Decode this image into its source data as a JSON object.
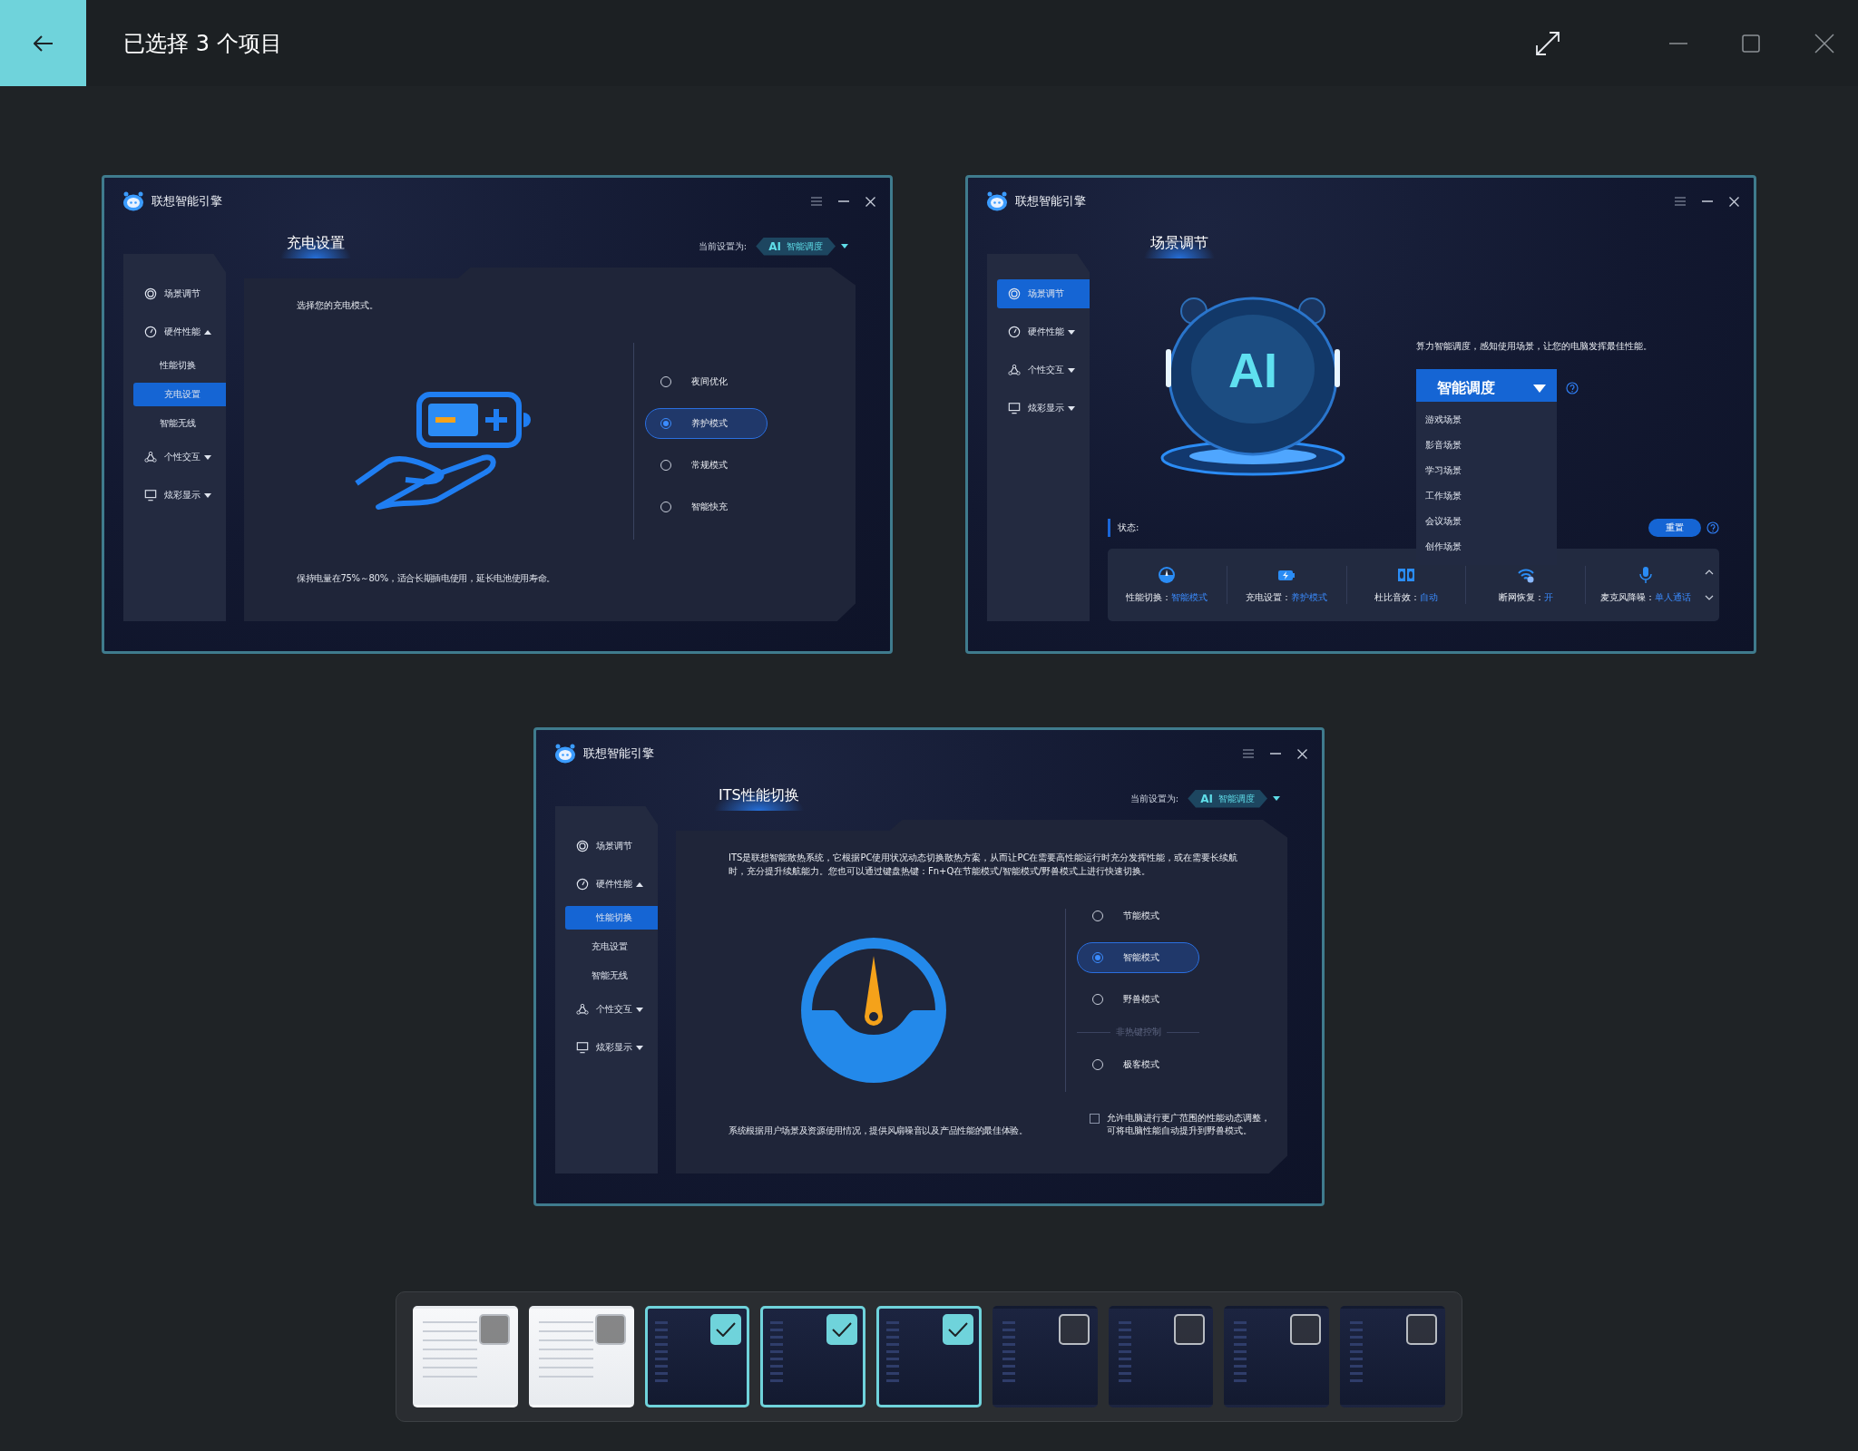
{
  "window": {
    "title": "已选择 3 个项目"
  },
  "screenshots": [
    {
      "app_title": "联想智能引擎",
      "page_title": "充电设置",
      "current_setting": {
        "label": "当前设置为:",
        "badge_prefix": "AI",
        "badge_text": "智能调度"
      },
      "sidebar": [
        {
          "label": "场景调节",
          "selected": false
        },
        {
          "label": "硬件性能",
          "selected": false,
          "expanded": true,
          "children": [
            {
              "label": "性能切换",
              "selected": false
            },
            {
              "label": "充电设置",
              "selected": true
            },
            {
              "label": "智能无线",
              "selected": false
            }
          ]
        },
        {
          "label": "个性交互",
          "selected": false,
          "expanded": false
        },
        {
          "label": "炫彩显示",
          "selected": false,
          "expanded": false
        }
      ],
      "content": {
        "kind": "charging",
        "description": "选择您的充电模式。",
        "footer": "保持电量在75%～80%，适合长期插电使用，延长电池使用寿命。",
        "options": [
          {
            "kind": "radio",
            "label": "夜间优化",
            "selected": false
          },
          {
            "kind": "radio",
            "label": "养护模式",
            "selected": true
          },
          {
            "kind": "radio",
            "label": "常规模式",
            "selected": false
          },
          {
            "kind": "radio",
            "label": "智能快充",
            "selected": false
          }
        ]
      }
    },
    {
      "app_title": "联想智能引擎",
      "page_title": "场景调节",
      "sidebar": [
        {
          "label": "场景调节",
          "selected": true
        },
        {
          "label": "硬件性能",
          "selected": false,
          "expanded": false
        },
        {
          "label": "个性交互",
          "selected": false,
          "expanded": false
        },
        {
          "label": "炫彩显示",
          "selected": false,
          "expanded": false
        }
      ],
      "content": {
        "kind": "scene",
        "mascot_text": "AI",
        "description": "算力智能调度，感知使用场景，让您的电脑发挥最佳性能。",
        "dropdown": {
          "label": "智能调度",
          "expanded": true,
          "options": [
            "游戏场景",
            "影音场景",
            "学习场景",
            "工作场景",
            "会议场景",
            "创作场景"
          ]
        },
        "status_label": "状态:",
        "reset_button": "重置",
        "status_items": [
          {
            "label": "性能切换：",
            "value": "智能模式"
          },
          {
            "label": "充电设置：",
            "value": "养护模式"
          },
          {
            "label": "杜比音效：",
            "value": "自动"
          },
          {
            "label": "断网恢复：",
            "value": "开"
          },
          {
            "label": "麦克风降噪：",
            "value": "单人通话"
          }
        ]
      }
    },
    {
      "app_title": "联想智能引擎",
      "page_title": "ITS性能切换",
      "current_setting": {
        "label": "当前设置为:",
        "badge_prefix": "AI",
        "badge_text": "智能调度"
      },
      "sidebar": [
        {
          "label": "场景调节",
          "selected": false
        },
        {
          "label": "硬件性能",
          "selected": false,
          "expanded": true,
          "children": [
            {
              "label": "性能切换",
              "selected": true
            },
            {
              "label": "充电设置",
              "selected": false
            },
            {
              "label": "智能无线",
              "selected": false
            }
          ]
        },
        {
          "label": "个性交互",
          "selected": false,
          "expanded": false
        },
        {
          "label": "炫彩显示",
          "selected": false,
          "expanded": false
        }
      ],
      "content": {
        "kind": "performance",
        "description": "ITS是联想智能散热系统，它根据PC使用状况动态切换散热方案，从而让PC在需要高性能运行时充分发挥性能，或在需要长续航时，充分提升续航能力。您也可以通过键盘热键：Fn+Q在节能模式/智能模式/野兽模式上进行快速切换。",
        "footer": "系统根据用户场景及资源使用情况，提供风扇噪音以及产品性能的最佳体验。",
        "options": [
          {
            "kind": "radio",
            "label": "节能模式",
            "selected": false
          },
          {
            "kind": "radio",
            "label": "智能模式",
            "selected": true
          },
          {
            "kind": "radio",
            "label": "野兽模式",
            "selected": false
          },
          {
            "kind": "separator",
            "label": "非热键控制"
          },
          {
            "kind": "radio",
            "label": "极客模式",
            "selected": false
          }
        ],
        "checkbox": {
          "checked": false,
          "label": "允许电脑进行更广范围的性能动态调整，可将电脑性能自动提升到野兽模式。"
        }
      }
    }
  ],
  "thumbnails": [
    {
      "kind": "light",
      "selected": false
    },
    {
      "kind": "light",
      "selected": false
    },
    {
      "kind": "dark",
      "selected": true
    },
    {
      "kind": "dark",
      "selected": true
    },
    {
      "kind": "dark",
      "selected": true
    },
    {
      "kind": "dark",
      "selected": false
    },
    {
      "kind": "dark",
      "selected": false
    },
    {
      "kind": "dark",
      "selected": false
    },
    {
      "kind": "dark",
      "selected": false
    }
  ]
}
